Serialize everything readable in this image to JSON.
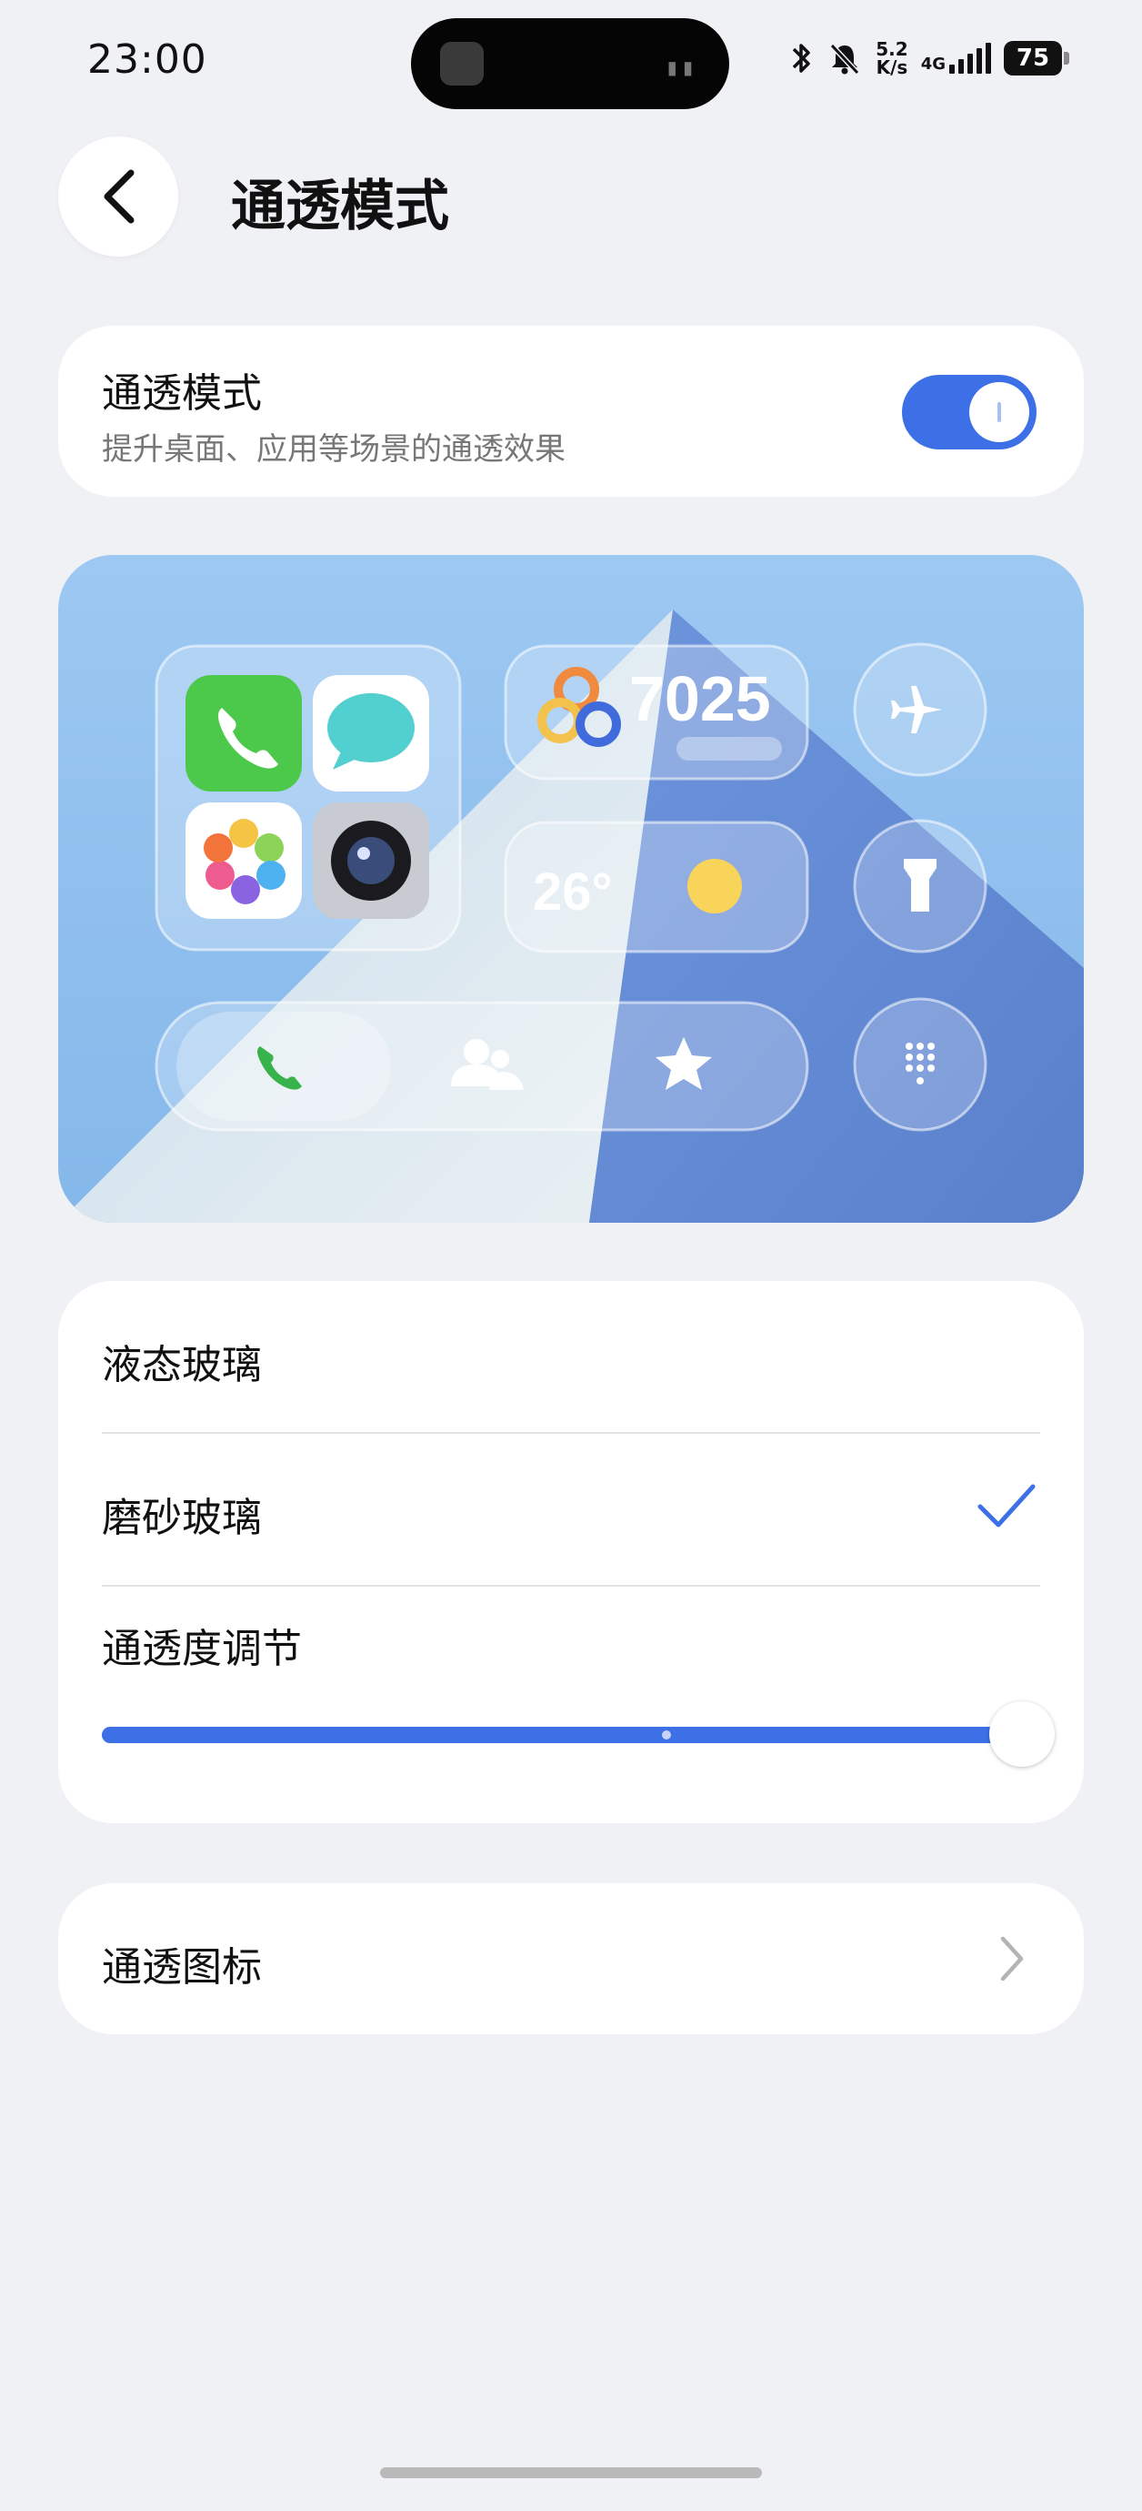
{
  "status_bar": {
    "time": "23:00",
    "net_speed_top": "5.2",
    "net_speed_bottom": "K/s",
    "network_type": "4G",
    "battery": "75"
  },
  "header": {
    "title": "通透模式"
  },
  "mode": {
    "title": "通透模式",
    "subtitle": "提升桌面、应用等场景的通透效果",
    "enabled": true
  },
  "preview": {
    "steps_count": "7025",
    "temperature": "26°",
    "colors": {
      "sky": "#8fc1ef",
      "mountain_light": "#dfe9ef",
      "mountain_dark": "#5f87d4"
    }
  },
  "glass_styles": {
    "options": [
      {
        "label": "液态玻璃",
        "selected": false
      },
      {
        "label": "磨砂玻璃",
        "selected": true
      }
    ],
    "transparency_label": "通透度调节",
    "transparency_value": 1.0
  },
  "icons_row": {
    "label": "通透图标"
  },
  "accent_color": "#3d6fe6"
}
